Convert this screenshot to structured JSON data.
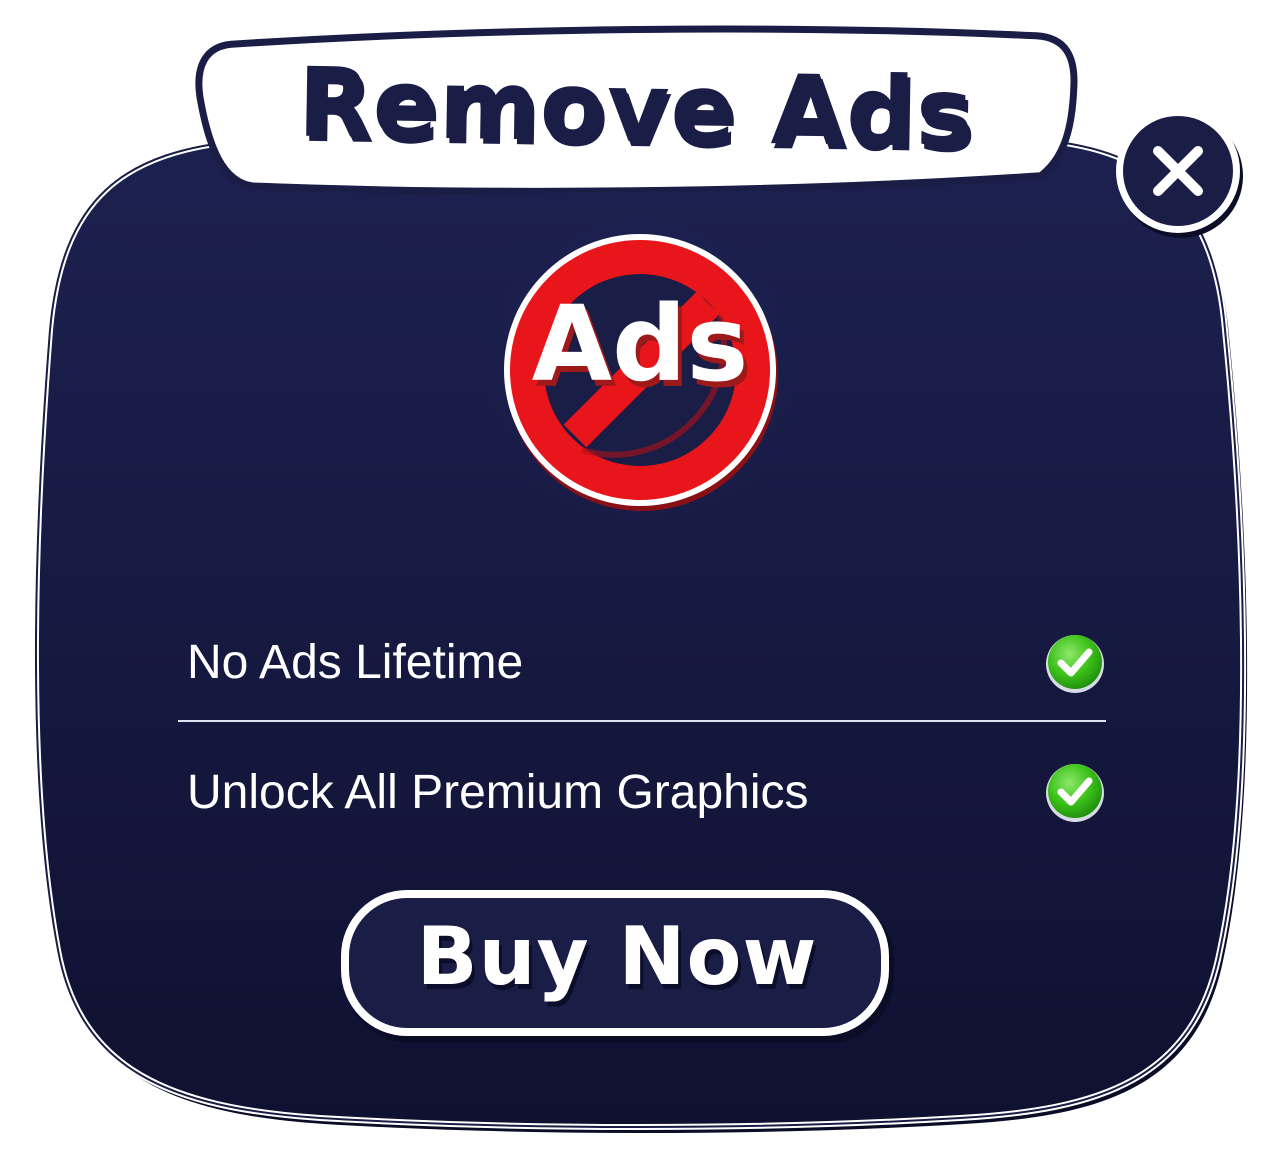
{
  "dialog": {
    "title": "Remove Ads",
    "badge_text": "Ads",
    "close_icon": "close-icon",
    "features": [
      {
        "label": "No Ads Lifetime",
        "icon": "check-icon",
        "checked": true
      },
      {
        "label": "Unlock All Premium Graphics",
        "icon": "check-icon",
        "checked": true
      }
    ],
    "buy_label": "Buy Now"
  },
  "colors": {
    "panel": "#1a1d45",
    "panel_dark": "#0f1130",
    "outline": "#ffffff",
    "banner_fill": "#ffffff",
    "title_text": "#1a1d45",
    "prohibit_red": "#e8151b",
    "check_green": "#3cc21a"
  }
}
